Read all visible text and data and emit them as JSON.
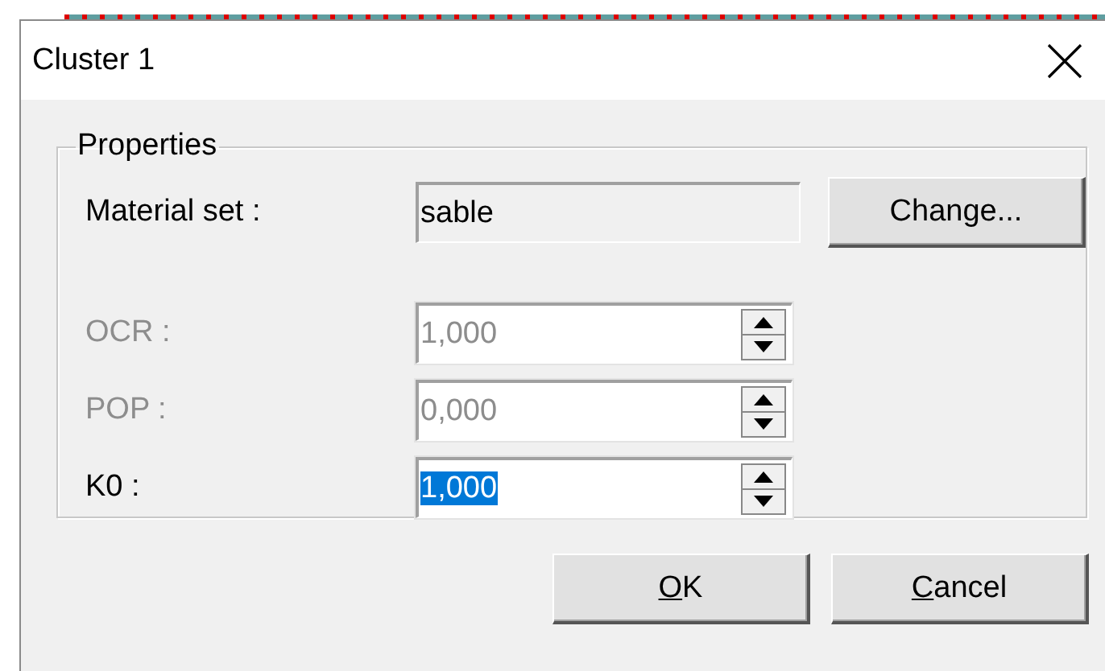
{
  "window": {
    "title": "Cluster 1"
  },
  "group": {
    "title": "Properties",
    "material": {
      "label": "Material set :",
      "value": "sable",
      "readonly": true,
      "button": "Change..."
    },
    "fields": [
      {
        "label": "OCR :",
        "value": "1,000",
        "disabled": true,
        "text_selected": false
      },
      {
        "label": "POP :",
        "value": "0,000",
        "disabled": true,
        "text_selected": false
      },
      {
        "label": "K0 :",
        "value": "1,000",
        "disabled": false,
        "text_selected": true
      }
    ]
  },
  "buttons": [
    {
      "label": "OK",
      "underline_first": true
    },
    {
      "label": "Cancel",
      "underline_first": true
    }
  ]
}
